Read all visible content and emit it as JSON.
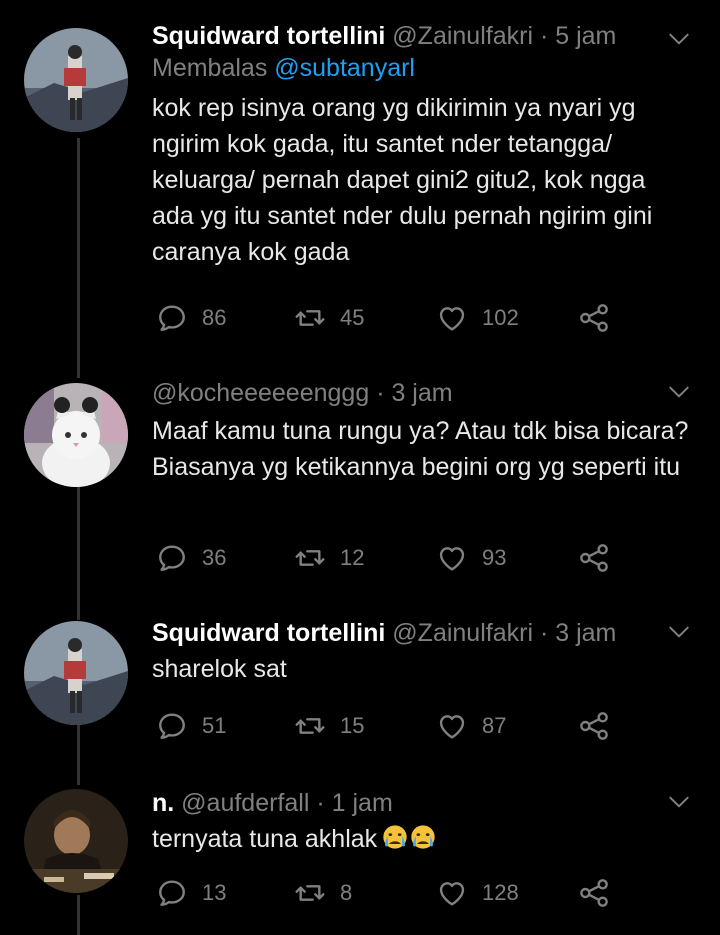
{
  "tweets": [
    {
      "name": "Squidward tortellini",
      "handle": "@Zainulfakri",
      "time": "· 5 jam",
      "reply_prefix": "Membalas ",
      "reply_to": "@subtanyarl",
      "text": "kok rep isinya orang yg dikirimin ya nyari yg ngirim kok gada, itu santet nder tetangga/ keluarga/ pernah dapet gini2 gitu2, kok ngga ada yg itu santet nder dulu pernah ngirim gini caranya kok gada",
      "replies": "86",
      "retweets": "45",
      "likes": "102"
    },
    {
      "name": "",
      "handle": "@kocheeeeeenggg",
      "time": "· 3 jam",
      "text": "Maaf kamu tuna rungu ya? Atau tdk bisa bicara? Biasanya yg ketikannya begini org yg seperti itu",
      "replies": "36",
      "retweets": "12",
      "likes": "93"
    },
    {
      "name": "Squidward tortellini",
      "handle": "@Zainulfakri",
      "time": "· 3 jam",
      "text": "sharelok sat",
      "replies": "51",
      "retweets": "15",
      "likes": "87"
    },
    {
      "name": "n.",
      "handle": "@aufderfall",
      "time": "· 1 jam",
      "text": "ternyata tuna akhlak",
      "emoji": [
        "crying-face",
        "crying-face"
      ],
      "replies": "13",
      "retweets": "8",
      "likes": "128"
    }
  ],
  "colors": {
    "background": "#000000",
    "text": "#e8e8e8",
    "secondary": "#808080",
    "mention": "#1da1f2",
    "thread_line": "#333333"
  },
  "icons": [
    "reply-icon",
    "retweet-icon",
    "like-icon",
    "share-icon",
    "chevron-down-icon"
  ]
}
